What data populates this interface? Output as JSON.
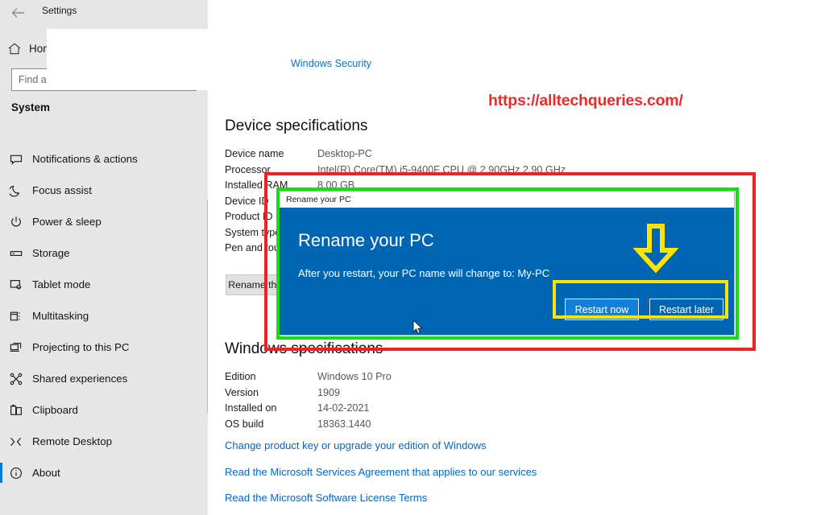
{
  "window": {
    "title": "Settings",
    "back_icon": "back-arrow-icon"
  },
  "sidebar": {
    "home_label": "Home",
    "home_icon": "home-icon",
    "search": {
      "placeholder": "Find a setting",
      "value": "",
      "icon": "search-icon"
    },
    "group_title": "System",
    "items": [
      {
        "label": "Notifications & actions",
        "icon": "notification-icon",
        "active": false
      },
      {
        "label": "Focus assist",
        "icon": "moon-icon",
        "active": false
      },
      {
        "label": "Power & sleep",
        "icon": "power-icon",
        "active": false
      },
      {
        "label": "Storage",
        "icon": "storage-icon",
        "active": false
      },
      {
        "label": "Tablet mode",
        "icon": "tablet-icon",
        "active": false
      },
      {
        "label": "Multitasking",
        "icon": "multitasking-icon",
        "active": false
      },
      {
        "label": "Projecting to this PC",
        "icon": "projecting-icon",
        "active": false
      },
      {
        "label": "Shared experiences",
        "icon": "share-icon",
        "active": false
      },
      {
        "label": "Clipboard",
        "icon": "clipboard-icon",
        "active": false
      },
      {
        "label": "Remote Desktop",
        "icon": "remote-desktop-icon",
        "active": false
      },
      {
        "label": "About",
        "icon": "info-icon",
        "active": true
      }
    ]
  },
  "main": {
    "windows_security_link": "Windows Security",
    "watermark": "https://alltechqueries.com/",
    "device_specifications": {
      "heading": "Device specifications",
      "rows": [
        {
          "label": "Device name",
          "value": "Desktop-PC"
        },
        {
          "label": "Processor",
          "value": "Intel(R) Core(TM) i5-9400F CPU @ 2.90GHz   2.90 GHz"
        },
        {
          "label": "Installed RAM",
          "value": "8.00 GB"
        },
        {
          "label": "Device ID",
          "value": ""
        },
        {
          "label": "Product ID",
          "value": ""
        },
        {
          "label": "System type",
          "value": ""
        },
        {
          "label": "Pen and touch",
          "value": ""
        }
      ],
      "rename_button": "Rename this PC"
    },
    "windows_specifications": {
      "heading": "Windows specifications",
      "rows": [
        {
          "label": "Edition",
          "value": "Windows 10 Pro"
        },
        {
          "label": "Version",
          "value": "1909"
        },
        {
          "label": "Installed on",
          "value": "14-02-2021"
        },
        {
          "label": "OS build",
          "value": "18363.1440"
        }
      ],
      "links": [
        "Change product key or upgrade your edition of Windows",
        "Read the Microsoft Services Agreement that applies to our services",
        "Read the Microsoft Software License Terms"
      ]
    }
  },
  "dialog": {
    "titlebar": "Rename your PC",
    "heading": "Rename your PC",
    "message": "After you restart, your PC name will change to: My-PC",
    "primary_button": "Restart now",
    "secondary_button": "Restart later"
  },
  "annotations": {
    "red_box_color": "#ee2222",
    "green_box_color": "#16dd16",
    "yellow_box_color": "#ffe400",
    "arrow_icon": "yellow-down-arrow-icon",
    "cursor_icon": "mouse-pointer-icon"
  },
  "colors": {
    "accent": "#0078d7",
    "dialog_blue": "#0066b4",
    "button_blue": "#1280d8",
    "link_blue": "#0066cc",
    "sidebar_bg": "#e6e6e6",
    "watermark_red": "#ee2a28"
  }
}
